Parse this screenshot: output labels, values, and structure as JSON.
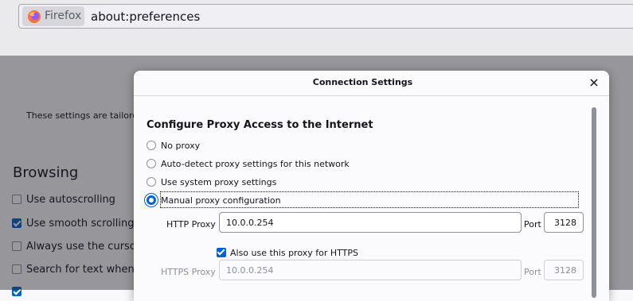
{
  "browser": {
    "identity_label": "Firefox",
    "url": "about:preferences"
  },
  "page": {
    "tailored_text": "These settings are tailore",
    "section_title": "Browsing",
    "checkboxes": [
      {
        "label": "Use autoscrolling",
        "checked": false
      },
      {
        "label": "Use smooth scrolling",
        "checked": true
      },
      {
        "label": "Always use the cursor",
        "checked": false
      },
      {
        "label": "Search for text when y",
        "checked": false
      },
      {
        "label": "",
        "checked": true
      }
    ]
  },
  "dialog": {
    "title": "Connection Settings",
    "group_title": "Configure Proxy Access to the Internet",
    "options": {
      "no_proxy": "No proxy",
      "auto_detect": "Auto-detect proxy settings for this network",
      "system": "Use system proxy settings",
      "manual": "Manual proxy configuration"
    },
    "selected_option": "manual",
    "http_proxy_label": "HTTP Proxy",
    "http_proxy_value": "10.0.0.254",
    "http_port_label": "Port",
    "http_port_value": "3128",
    "https_checkbox_label": "Also use this proxy for HTTPS",
    "https_checkbox_checked": true,
    "https_proxy_label": "HTTPS Proxy",
    "https_proxy_value": "10.0.0.254",
    "https_port_label": "Port",
    "https_port_value": "3128"
  },
  "colors": {
    "accent": "#0061e0",
    "overlay": "#1c1b22"
  }
}
